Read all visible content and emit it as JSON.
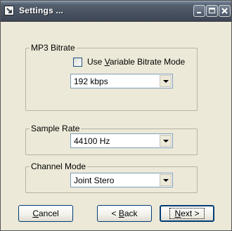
{
  "window": {
    "title": "Settings ..."
  },
  "mp3_bitrate": {
    "legend": "MP3 Bitrate",
    "vbr_checkbox": {
      "label_before": "Use ",
      "label_underlined": "V",
      "label_after": "ariable Bitrate Mode",
      "checked": false
    },
    "bitrate_select": {
      "value": "192 kbps"
    }
  },
  "sample_rate": {
    "legend": "Sample Rate",
    "select_value": "44100 Hz"
  },
  "channel_mode": {
    "legend": "Channel Mode",
    "select_value": "Joint Stero"
  },
  "buttons": {
    "cancel": {
      "underlined": "C",
      "rest": "ancel"
    },
    "back": {
      "prefix": "< ",
      "underlined": "B",
      "rest": "ack"
    },
    "next": {
      "underlined": "N",
      "rest": "ext",
      "suffix": " >"
    }
  },
  "icons": {
    "app": "app-icon",
    "minimize": "minimize-icon",
    "maximize": "maximize-icon",
    "close": "close-icon",
    "dropdown": "chevron-down-icon"
  },
  "colors": {
    "titlebar": "#4a5362",
    "dialog_bg": "#ece9d8",
    "button_border": "#003c74",
    "field_border": "#7f9db9"
  }
}
